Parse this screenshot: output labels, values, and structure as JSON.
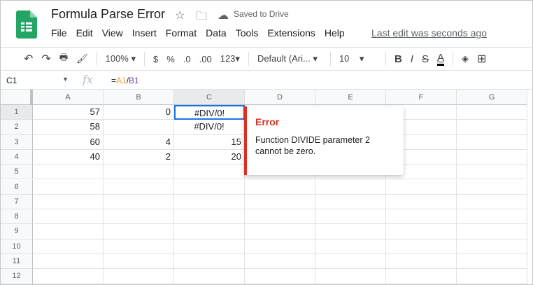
{
  "header": {
    "title": "Formula Parse Error",
    "saved": "Saved to Drive",
    "last_edit": "Last edit was seconds ago",
    "menu": [
      "File",
      "Edit",
      "View",
      "Insert",
      "Format",
      "Data",
      "Tools",
      "Extensions",
      "Help"
    ]
  },
  "toolbar": {
    "zoom": "100%",
    "currency": "$",
    "percent": "%",
    "dec_less": ".0",
    "dec_more": ".00",
    "format_more": "123▾",
    "font": "Default (Ari...",
    "font_size": "10",
    "bold": "B",
    "italic": "I",
    "strike": "S",
    "text_color": "A"
  },
  "formula_bar": {
    "name_box": "C1",
    "fx": "fx",
    "formula_eq": "=",
    "ref1": "A1",
    "slash": "/",
    "ref2": "B1"
  },
  "columns": [
    "A",
    "B",
    "C",
    "D",
    "E",
    "F",
    "G"
  ],
  "rows": [
    "1",
    "2",
    "3",
    "4",
    "5",
    "6",
    "7",
    "8",
    "9",
    "10",
    "11",
    "12"
  ],
  "cells": {
    "A1": "57",
    "B1": "0",
    "C1": "#DIV/0!",
    "A2": "58",
    "C2": "#DIV/0!",
    "A3": "60",
    "B3": "4",
    "C3": "15",
    "A4": "40",
    "B4": "2",
    "C4": "20"
  },
  "error_popup": {
    "title": "Error",
    "message": "Function DIVIDE parameter 2 cannot be zero."
  }
}
